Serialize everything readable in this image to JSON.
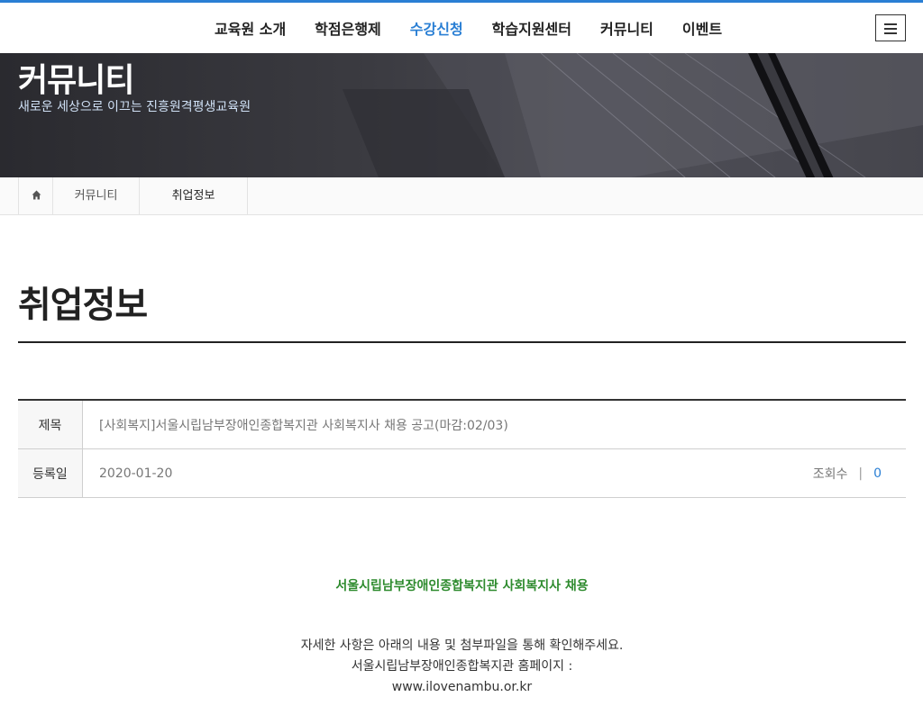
{
  "nav": {
    "items": [
      "교육원 소개",
      "학점은행제",
      "수강신청",
      "학습지원센터",
      "커뮤니티",
      "이벤트"
    ],
    "active_index": 2
  },
  "icons": {
    "menu": "hamburger-menu-icon",
    "home": "home-icon"
  },
  "colors": {
    "accent": "#2a7fd4",
    "highlight_text": "#2e8b2e",
    "top_line": "#2a7fd4"
  },
  "hero": {
    "title": "커뮤니티",
    "subtitle": "새로운 세상으로 이끄는 진흥원격평생교육원"
  },
  "breadcrumb": {
    "items": [
      "커뮤니티",
      "취업정보"
    ]
  },
  "page": {
    "title": "취업정보"
  },
  "post": {
    "subject_label": "제목",
    "subject": "[사회복지]서울시립남부장애인종합복지관 사회복지사 채용 공고(마감:02/03)",
    "date_label": "등록일",
    "date": "2020-01-20",
    "views_label": "조회수",
    "views_sep": "|",
    "views": "0"
  },
  "content": {
    "heading": "서울시립남부장애인종합복지관 사회복지사 채용",
    "lines": [
      "자세한 사항은 아래의 내용 및 첨부파일을 통해 확인해주세요.",
      "서울시립남부장애인종합복지관 홈페이지 :",
      "www.ilovenambu.or.kr"
    ]
  }
}
